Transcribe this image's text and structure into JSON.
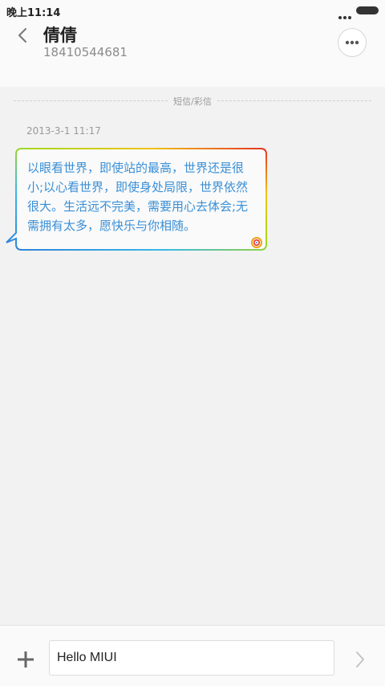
{
  "status_bar": {
    "time": "晚上11:14",
    "signal_icon": "more-dots-icon",
    "battery_icon": "battery-icon"
  },
  "header": {
    "contact_name": "倩倩",
    "contact_number": "18410544681",
    "back_icon": "chevron-left-icon",
    "more_icon": "more-horizontal-icon"
  },
  "conversation": {
    "channel_label": "短信/彩信",
    "messages": [
      {
        "timestamp": "2013-3-1 11:17",
        "text": "以眼看世界，即使站的最高，世界还是很小;以心看世界，即使身处局限，世界依然很大。生活远不完美，需要用心去体会;无需拥有太多，愿快乐与你相随。",
        "badge_icon": "miui-swirl-icon"
      }
    ]
  },
  "compose": {
    "input_value": "Hello MIUI",
    "add_icon": "plus-icon",
    "send_icon": "chevron-right-icon"
  },
  "colors": {
    "page_background": "#f2f2f2",
    "message_text": "#3a8fd6",
    "secondary_text": "#9a9a9a"
  }
}
